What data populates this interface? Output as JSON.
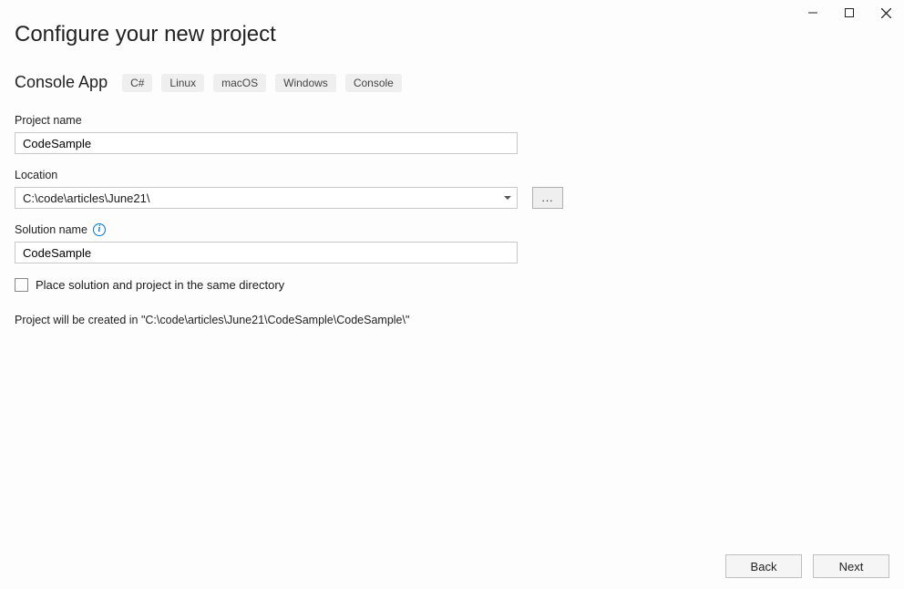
{
  "window": {
    "title": "Configure your new project",
    "subtitle": "Console App",
    "tags": [
      "C#",
      "Linux",
      "macOS",
      "Windows",
      "Console"
    ]
  },
  "fields": {
    "projectName": {
      "label": "Project name",
      "value": "CodeSample"
    },
    "location": {
      "label": "Location",
      "value": "C:\\code\\articles\\June21\\",
      "browseLabel": "..."
    },
    "solutionName": {
      "label": "Solution name",
      "value": "CodeSample"
    },
    "sameDir": {
      "label": "Place solution and project in the same directory",
      "checked": false
    }
  },
  "summary": "Project will be created in \"C:\\code\\articles\\June21\\CodeSample\\CodeSample\\\"",
  "footer": {
    "back": "Back",
    "next": "Next"
  }
}
